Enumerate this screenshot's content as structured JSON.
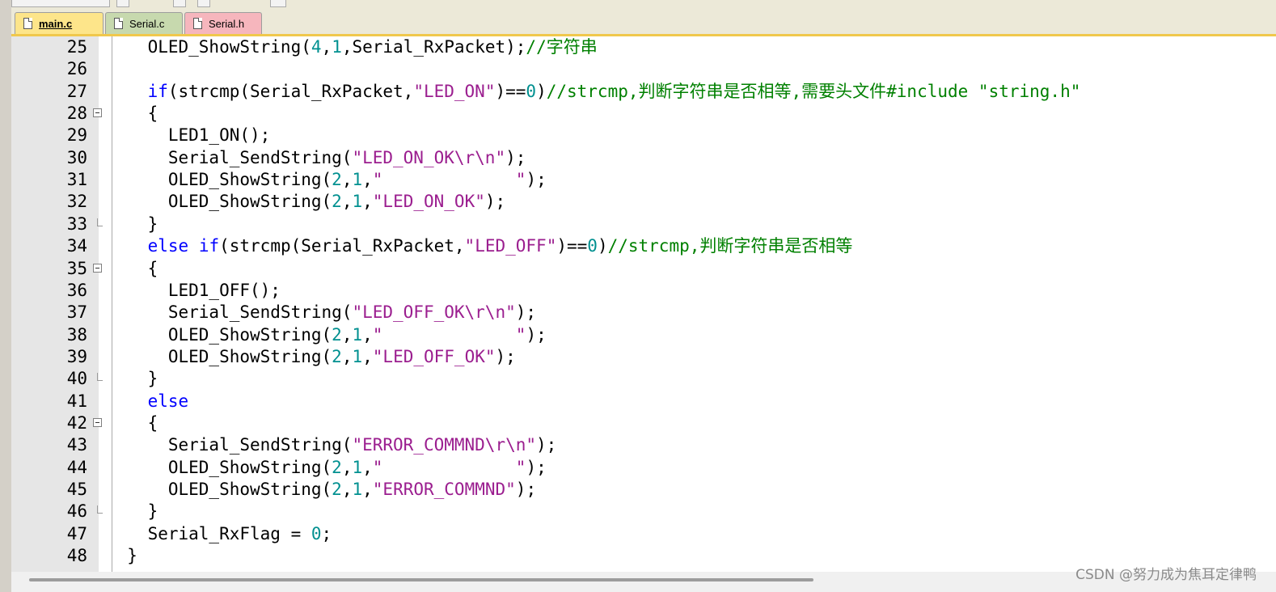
{
  "tabs": [
    {
      "label": "main.c",
      "active": true,
      "color": "#fde58a"
    },
    {
      "label": "Serial.c",
      "active": false,
      "color": "#c7d9ae"
    },
    {
      "label": "Serial.h",
      "active": false,
      "color": "#f6b6bd"
    }
  ],
  "colors": {
    "keyword": "#0000ff",
    "string": "#9b1e8f",
    "number": "#009090",
    "comment": "#008000",
    "text": "#000000"
  },
  "lines": [
    {
      "num": "25",
      "fold": "",
      "tokens": [
        {
          "t": "    OLED_ShowString(",
          "c": "p"
        },
        {
          "t": "4",
          "c": "n"
        },
        {
          "t": ",",
          "c": "p"
        },
        {
          "t": "1",
          "c": "n"
        },
        {
          "t": ",Serial_RxPacket);",
          "c": "p"
        },
        {
          "t": "//字符串",
          "c": "c"
        }
      ]
    },
    {
      "num": "26",
      "fold": "",
      "tokens": []
    },
    {
      "num": "27",
      "fold": "",
      "tokens": [
        {
          "t": "    ",
          "c": "p"
        },
        {
          "t": "if",
          "c": "k"
        },
        {
          "t": "(strcmp(Serial_RxPacket,",
          "c": "p"
        },
        {
          "t": "\"LED_ON\"",
          "c": "s"
        },
        {
          "t": ")==",
          "c": "p"
        },
        {
          "t": "0",
          "c": "n"
        },
        {
          "t": ")",
          "c": "p"
        },
        {
          "t": "//strcmp,判断字符串是否相等,需要头文件#include \"string.h\"",
          "c": "c"
        }
      ]
    },
    {
      "num": "28",
      "fold": "open",
      "tokens": [
        {
          "t": "    {",
          "c": "p"
        }
      ]
    },
    {
      "num": "29",
      "fold": "",
      "tokens": [
        {
          "t": "      LED1_ON();",
          "c": "p"
        }
      ]
    },
    {
      "num": "30",
      "fold": "",
      "tokens": [
        {
          "t": "      Serial_SendString(",
          "c": "p"
        },
        {
          "t": "\"LED_ON_OK\\r\\n\"",
          "c": "s"
        },
        {
          "t": ");",
          "c": "p"
        }
      ]
    },
    {
      "num": "31",
      "fold": "",
      "tokens": [
        {
          "t": "      OLED_ShowString(",
          "c": "p"
        },
        {
          "t": "2",
          "c": "n"
        },
        {
          "t": ",",
          "c": "p"
        },
        {
          "t": "1",
          "c": "n"
        },
        {
          "t": ",",
          "c": "p"
        },
        {
          "t": "\"             \"",
          "c": "s"
        },
        {
          "t": ");",
          "c": "p"
        }
      ]
    },
    {
      "num": "32",
      "fold": "",
      "tokens": [
        {
          "t": "      OLED_ShowString(",
          "c": "p"
        },
        {
          "t": "2",
          "c": "n"
        },
        {
          "t": ",",
          "c": "p"
        },
        {
          "t": "1",
          "c": "n"
        },
        {
          "t": ",",
          "c": "p"
        },
        {
          "t": "\"LED_ON_OK\"",
          "c": "s"
        },
        {
          "t": ");",
          "c": "p"
        }
      ]
    },
    {
      "num": "33",
      "fold": "end",
      "tokens": [
        {
          "t": "    }",
          "c": "p"
        }
      ]
    },
    {
      "num": "34",
      "fold": "",
      "tokens": [
        {
          "t": "    ",
          "c": "p"
        },
        {
          "t": "else",
          "c": "k"
        },
        {
          "t": " ",
          "c": "p"
        },
        {
          "t": "if",
          "c": "k"
        },
        {
          "t": "(strcmp(Serial_RxPacket,",
          "c": "p"
        },
        {
          "t": "\"LED_OFF\"",
          "c": "s"
        },
        {
          "t": ")==",
          "c": "p"
        },
        {
          "t": "0",
          "c": "n"
        },
        {
          "t": ")",
          "c": "p"
        },
        {
          "t": "//strcmp,判断字符串是否相等",
          "c": "c"
        }
      ]
    },
    {
      "num": "35",
      "fold": "open",
      "tokens": [
        {
          "t": "    {",
          "c": "p"
        }
      ]
    },
    {
      "num": "36",
      "fold": "",
      "tokens": [
        {
          "t": "      LED1_OFF();",
          "c": "p"
        }
      ]
    },
    {
      "num": "37",
      "fold": "",
      "tokens": [
        {
          "t": "      Serial_SendString(",
          "c": "p"
        },
        {
          "t": "\"LED_OFF_OK\\r\\n\"",
          "c": "s"
        },
        {
          "t": ");",
          "c": "p"
        }
      ]
    },
    {
      "num": "38",
      "fold": "",
      "tokens": [
        {
          "t": "      OLED_ShowString(",
          "c": "p"
        },
        {
          "t": "2",
          "c": "n"
        },
        {
          "t": ",",
          "c": "p"
        },
        {
          "t": "1",
          "c": "n"
        },
        {
          "t": ",",
          "c": "p"
        },
        {
          "t": "\"             \"",
          "c": "s"
        },
        {
          "t": ");",
          "c": "p"
        }
      ]
    },
    {
      "num": "39",
      "fold": "",
      "tokens": [
        {
          "t": "      OLED_ShowString(",
          "c": "p"
        },
        {
          "t": "2",
          "c": "n"
        },
        {
          "t": ",",
          "c": "p"
        },
        {
          "t": "1",
          "c": "n"
        },
        {
          "t": ",",
          "c": "p"
        },
        {
          "t": "\"LED_OFF_OK\"",
          "c": "s"
        },
        {
          "t": ");",
          "c": "p"
        }
      ]
    },
    {
      "num": "40",
      "fold": "end",
      "tokens": [
        {
          "t": "    }",
          "c": "p"
        }
      ]
    },
    {
      "num": "41",
      "fold": "",
      "tokens": [
        {
          "t": "    ",
          "c": "p"
        },
        {
          "t": "else",
          "c": "k"
        }
      ]
    },
    {
      "num": "42",
      "fold": "open",
      "tokens": [
        {
          "t": "    {",
          "c": "p"
        }
      ]
    },
    {
      "num": "43",
      "fold": "",
      "tokens": [
        {
          "t": "      Serial_SendString(",
          "c": "p"
        },
        {
          "t": "\"ERROR_COMMND\\r\\n\"",
          "c": "s"
        },
        {
          "t": ");",
          "c": "p"
        }
      ]
    },
    {
      "num": "44",
      "fold": "",
      "tokens": [
        {
          "t": "      OLED_ShowString(",
          "c": "p"
        },
        {
          "t": "2",
          "c": "n"
        },
        {
          "t": ",",
          "c": "p"
        },
        {
          "t": "1",
          "c": "n"
        },
        {
          "t": ",",
          "c": "p"
        },
        {
          "t": "\"             \"",
          "c": "s"
        },
        {
          "t": ");",
          "c": "p"
        }
      ]
    },
    {
      "num": "45",
      "fold": "",
      "tokens": [
        {
          "t": "      OLED_ShowString(",
          "c": "p"
        },
        {
          "t": "2",
          "c": "n"
        },
        {
          "t": ",",
          "c": "p"
        },
        {
          "t": "1",
          "c": "n"
        },
        {
          "t": ",",
          "c": "p"
        },
        {
          "t": "\"ERROR_COMMND\"",
          "c": "s"
        },
        {
          "t": ");",
          "c": "p"
        }
      ]
    },
    {
      "num": "46",
      "fold": "end",
      "tokens": [
        {
          "t": "    }",
          "c": "p"
        }
      ]
    },
    {
      "num": "47",
      "fold": "",
      "tokens": [
        {
          "t": "    Serial_RxFlag = ",
          "c": "p"
        },
        {
          "t": "0",
          "c": "n"
        },
        {
          "t": ";",
          "c": "p"
        }
      ]
    },
    {
      "num": "48",
      "fold": "",
      "tokens": [
        {
          "t": "  }",
          "c": "p"
        }
      ]
    }
  ],
  "watermark": "CSDN @努力成为焦耳定律鸭"
}
